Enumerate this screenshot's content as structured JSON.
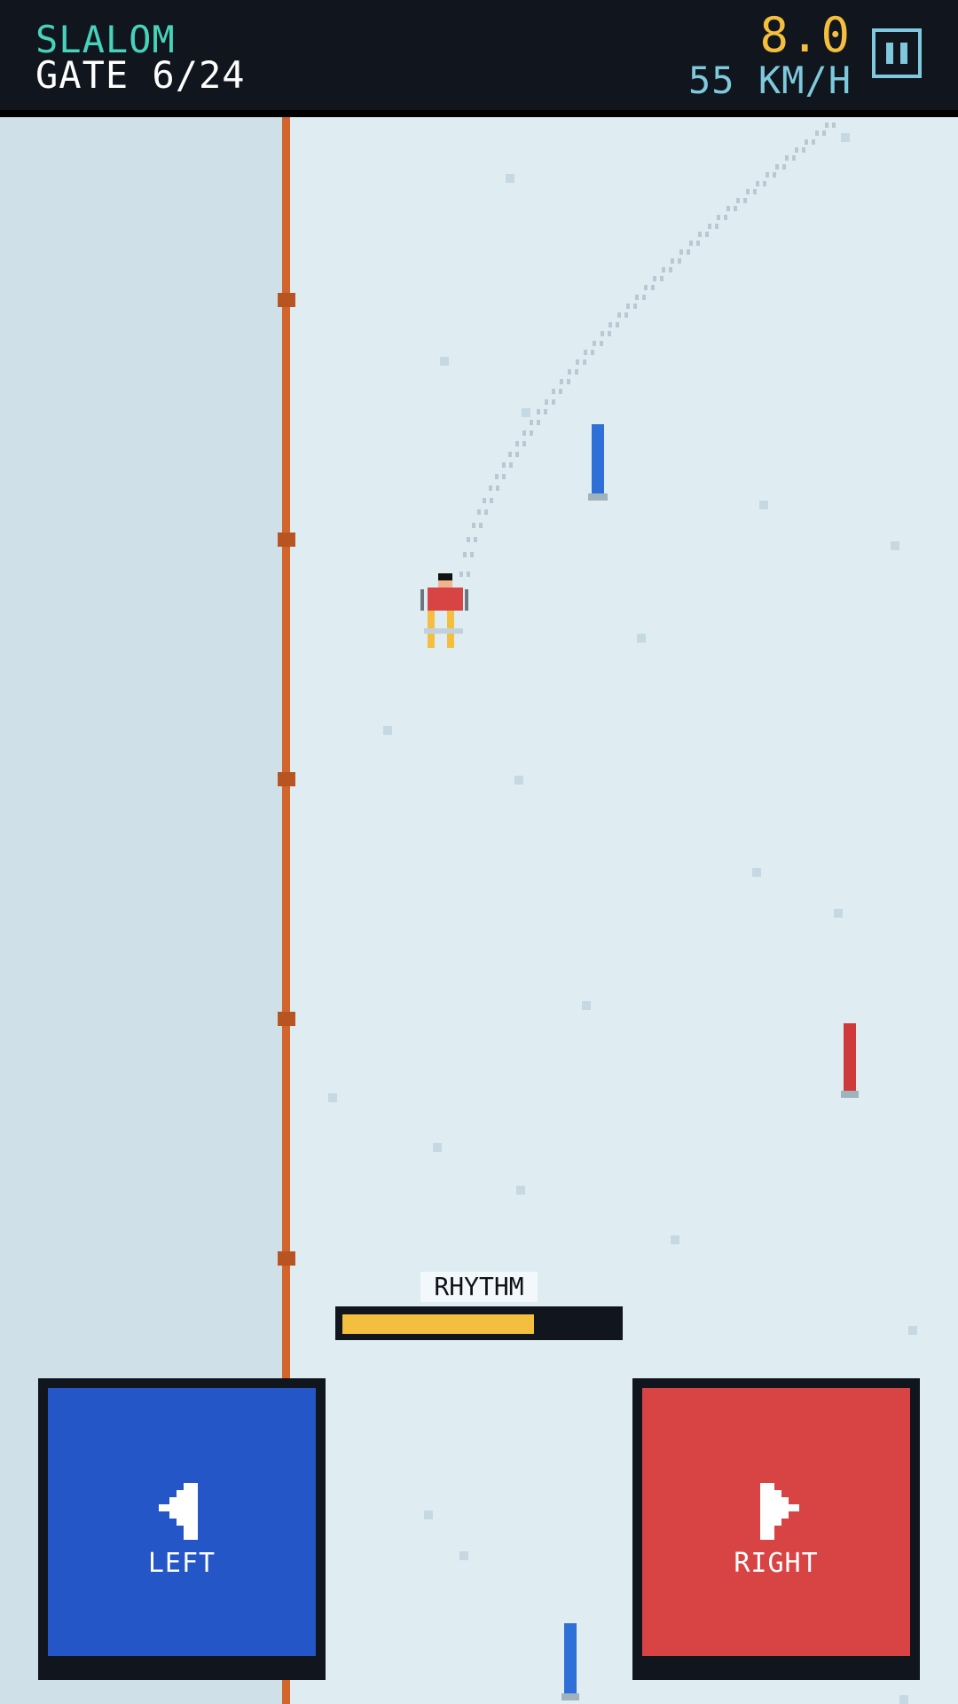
{
  "hud": {
    "mode": "SLALOM",
    "gate": "GATE 6/24",
    "time": "8.0",
    "speed": "55 KM/H",
    "pause_icon": "pause-icon"
  },
  "course": {
    "gates": [
      {
        "color": "blue",
        "hex": "#2f6fd8"
      },
      {
        "color": "red",
        "hex": "#d0393b"
      },
      {
        "color": "blue",
        "hex": "#2f6fd8"
      }
    ],
    "fence_color": "#d2652c"
  },
  "player": {
    "jacket": "#d84444",
    "skis": "#f4be3e"
  },
  "rhythm": {
    "label": "RHYTHM",
    "level": 0.7
  },
  "controls": {
    "left": {
      "label": "LEFT",
      "icon": "arrow-left-icon"
    },
    "right": {
      "label": "RIGHT",
      "icon": "arrow-right-icon"
    }
  }
}
